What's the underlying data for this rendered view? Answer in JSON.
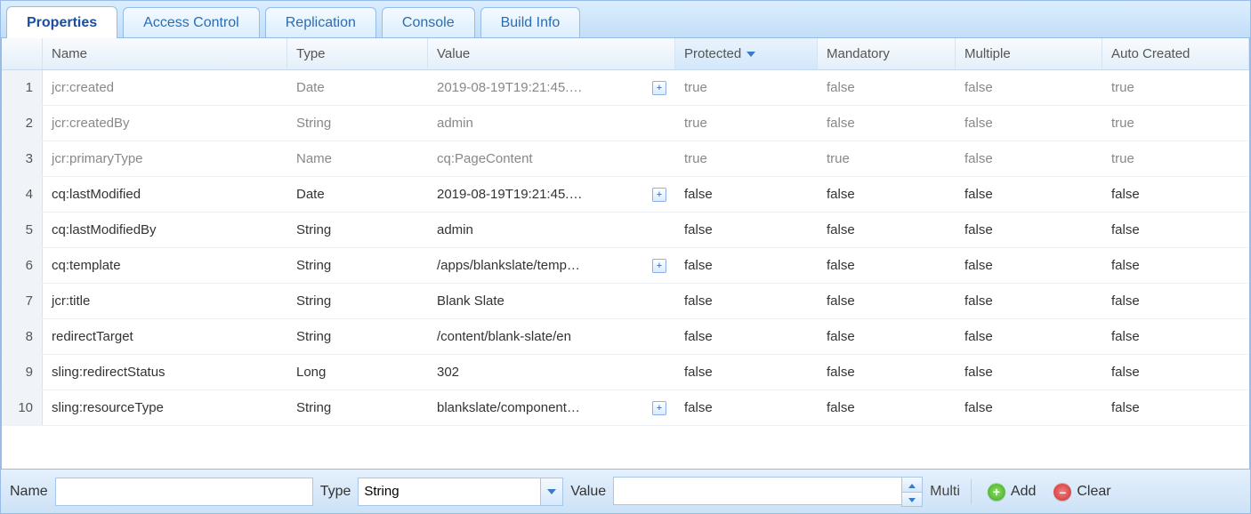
{
  "tabs": [
    {
      "label": "Properties",
      "active": true
    },
    {
      "label": "Access Control",
      "active": false
    },
    {
      "label": "Replication",
      "active": false
    },
    {
      "label": "Console",
      "active": false
    },
    {
      "label": "Build Info",
      "active": false
    }
  ],
  "columns": {
    "name": "Name",
    "type": "Type",
    "value": "Value",
    "protected": "Protected",
    "mandatory": "Mandatory",
    "multiple": "Multiple",
    "autocreated": "Auto Created"
  },
  "sort": {
    "column": "protected",
    "direction": "desc"
  },
  "rows": [
    {
      "n": "1",
      "name": "jcr:created",
      "type": "Date",
      "value": "2019-08-19T19:21:45.…",
      "expand": true,
      "protected": "true",
      "mandatory": "false",
      "multiple": "false",
      "autocreated": "true",
      "dim": true
    },
    {
      "n": "2",
      "name": "jcr:createdBy",
      "type": "String",
      "value": "admin",
      "expand": false,
      "protected": "true",
      "mandatory": "false",
      "multiple": "false",
      "autocreated": "true",
      "dim": true
    },
    {
      "n": "3",
      "name": "jcr:primaryType",
      "type": "Name",
      "value": "cq:PageContent",
      "expand": false,
      "protected": "true",
      "mandatory": "true",
      "multiple": "false",
      "autocreated": "true",
      "dim": true
    },
    {
      "n": "4",
      "name": "cq:lastModified",
      "type": "Date",
      "value": "2019-08-19T19:21:45.…",
      "expand": true,
      "protected": "false",
      "mandatory": "false",
      "multiple": "false",
      "autocreated": "false",
      "dim": false
    },
    {
      "n": "5",
      "name": "cq:lastModifiedBy",
      "type": "String",
      "value": "admin",
      "expand": false,
      "protected": "false",
      "mandatory": "false",
      "multiple": "false",
      "autocreated": "false",
      "dim": false
    },
    {
      "n": "6",
      "name": "cq:template",
      "type": "String",
      "value": "/apps/blankslate/temp…",
      "expand": true,
      "protected": "false",
      "mandatory": "false",
      "multiple": "false",
      "autocreated": "false",
      "dim": false
    },
    {
      "n": "7",
      "name": "jcr:title",
      "type": "String",
      "value": "Blank Slate",
      "expand": false,
      "protected": "false",
      "mandatory": "false",
      "multiple": "false",
      "autocreated": "false",
      "dim": false
    },
    {
      "n": "8",
      "name": "redirectTarget",
      "type": "String",
      "value": "/content/blank-slate/en",
      "expand": false,
      "protected": "false",
      "mandatory": "false",
      "multiple": "false",
      "autocreated": "false",
      "dim": false
    },
    {
      "n": "9",
      "name": "sling:redirectStatus",
      "type": "Long",
      "value": "302",
      "expand": false,
      "protected": "false",
      "mandatory": "false",
      "multiple": "false",
      "autocreated": "false",
      "dim": false
    },
    {
      "n": "10",
      "name": "sling:resourceType",
      "type": "String",
      "value": "blankslate/component…",
      "expand": true,
      "protected": "false",
      "mandatory": "false",
      "multiple": "false",
      "autocreated": "false",
      "dim": false
    }
  ],
  "form": {
    "name_label": "Name",
    "name_value": "",
    "type_label": "Type",
    "type_value": "String",
    "value_label": "Value",
    "value_value": "",
    "multi_label": "Multi",
    "add_label": "Add",
    "clear_label": "Clear"
  }
}
